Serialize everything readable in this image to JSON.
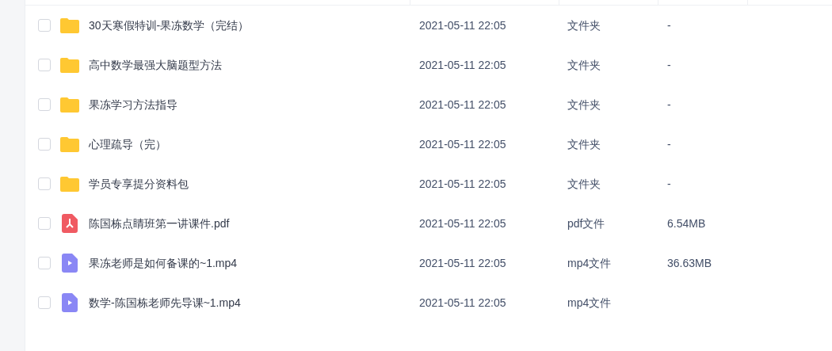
{
  "files": [
    {
      "kind": "folder",
      "name": "30天寒假特训-果冻数学（完结）",
      "date": "2021-05-11 22:05",
      "type": "文件夹",
      "size": "-",
      "checked": false
    },
    {
      "kind": "folder",
      "name": "高中数学最强大脑题型方法",
      "date": "2021-05-11 22:05",
      "type": "文件夹",
      "size": "-",
      "checked": false
    },
    {
      "kind": "folder",
      "name": "果冻学习方法指导",
      "date": "2021-05-11 22:05",
      "type": "文件夹",
      "size": "-",
      "checked": false
    },
    {
      "kind": "folder",
      "name": "心理疏导（完）",
      "date": "2021-05-11 22:05",
      "type": "文件夹",
      "size": "-",
      "checked": false
    },
    {
      "kind": "folder",
      "name": "学员专享提分资料包",
      "date": "2021-05-11 22:05",
      "type": "文件夹",
      "size": "-",
      "checked": false
    },
    {
      "kind": "pdf",
      "name": "陈国栋点睛班第一讲课件.pdf",
      "date": "2021-05-11 22:05",
      "type": "pdf文件",
      "size": "6.54MB",
      "checked": false
    },
    {
      "kind": "video",
      "name": "果冻老师是如何备课的~1.mp4",
      "date": "2021-05-11 22:05",
      "type": "mp4文件",
      "size": "36.63MB",
      "checked": false
    },
    {
      "kind": "video",
      "name": "数学-陈国栋老师先导课~1.mp4",
      "date": "2021-05-11 22:05",
      "type": "mp4文件",
      "checked": false
    }
  ]
}
